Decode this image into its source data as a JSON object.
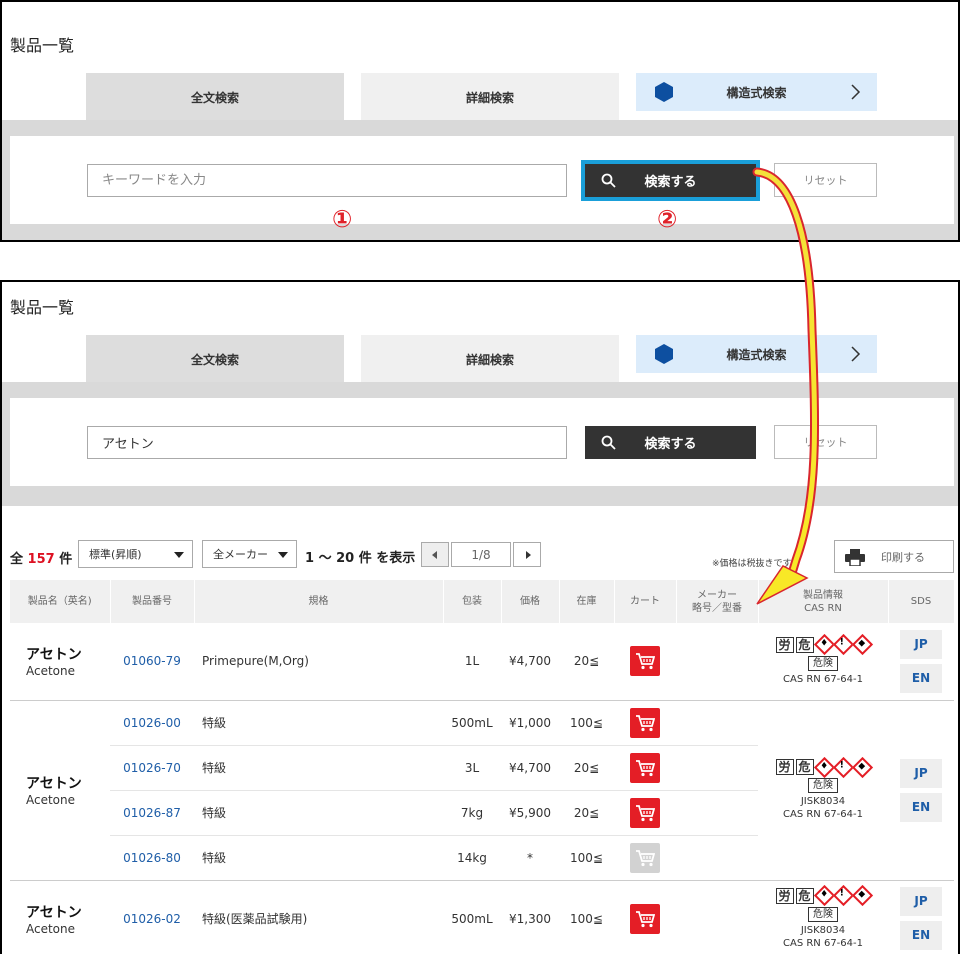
{
  "page_title": "製品一覧",
  "tabs": {
    "fulltext": "全文検索",
    "detail": "詳細検索",
    "structure": "構造式検索"
  },
  "panel1": {
    "placeholder": "キーワードを入力",
    "search_label": "検索する",
    "reset_label": "リセット",
    "step1": "①",
    "step2": "②"
  },
  "panel2": {
    "input_value": "アセトン",
    "search_label": "検索する",
    "reset_label": "リセット"
  },
  "results": {
    "total_prefix": "全 ",
    "total_count": "157",
    "total_suffix": " 件",
    "sort_value": "標準(昇順)",
    "maker_value": "全メーカー",
    "range_text": "1 ～ 20 件 を表示",
    "page_text": "1/8",
    "tax_note": "※価格は税抜きです。",
    "print_label": "印刷する",
    "columns": [
      "製品名（英名)",
      "製品番号",
      "規格",
      "包装",
      "価格",
      "在庫",
      "カート",
      "メーカー\n略号／型番",
      "製品情報\nCAS RN",
      "SDS"
    ],
    "groups": [
      {
        "name_jp": "アセトン",
        "name_en": "Acetone",
        "rows": [
          {
            "pno": "01060-79",
            "spec": "Primepure(M,Org)",
            "pack": "1L",
            "price": "¥4,700",
            "stock": "20≦",
            "cart_active": true
          }
        ],
        "danger": "危険",
        "std": "",
        "cas": "CAS RN 67-64-1",
        "sds": [
          "JP",
          "EN"
        ]
      },
      {
        "name_jp": "アセトン",
        "name_en": "Acetone",
        "rows": [
          {
            "pno": "01026-00",
            "spec": "特級",
            "pack": "500mL",
            "price": "¥1,000",
            "stock": "100≦",
            "cart_active": true
          },
          {
            "pno": "01026-70",
            "spec": "特級",
            "pack": "3L",
            "price": "¥4,700",
            "stock": "20≦",
            "cart_active": true
          },
          {
            "pno": "01026-87",
            "spec": "特級",
            "pack": "7kg",
            "price": "¥5,900",
            "stock": "20≦",
            "cart_active": true
          },
          {
            "pno": "01026-80",
            "spec": "特級",
            "pack": "14kg",
            "price": "*",
            "stock": "100≦",
            "cart_active": false
          }
        ],
        "danger": "危険",
        "std": "JISK8034",
        "cas": "CAS RN 67-64-1",
        "sds": [
          "JP",
          "EN"
        ]
      },
      {
        "name_jp": "アセトン",
        "name_en": "Acetone",
        "rows": [
          {
            "pno": "01026-02",
            "spec": "特級(医薬品試験用)",
            "pack": "500mL",
            "price": "¥1,300",
            "stock": "100≦",
            "cart_active": true
          }
        ],
        "danger": "危険",
        "std": "JISK8034",
        "cas": "CAS RN 67-64-1",
        "sds": [
          "JP",
          "EN"
        ]
      }
    ],
    "hazard_kanji": [
      "労",
      "危"
    ],
    "colors": {
      "accent_red": "#e41e26",
      "link_blue": "#1f5ea8",
      "highlight": "#1a9fd9"
    }
  }
}
